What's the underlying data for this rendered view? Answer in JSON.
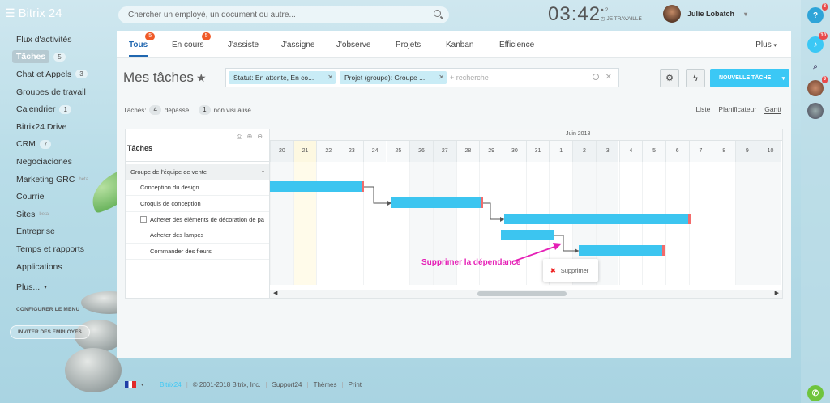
{
  "app": {
    "logo_a": "Bitrix",
    "logo_b": "24"
  },
  "search": {
    "placeholder": "Chercher un employé, un document ou autre..."
  },
  "clock": {
    "time": "03:42",
    "count": "2",
    "status": "JE TRAVAILLE"
  },
  "user": {
    "name": "Julie Lobatch"
  },
  "sidebar": {
    "items": [
      {
        "label": "Flux d'activités",
        "badge": ""
      },
      {
        "label": "Tâches",
        "badge": "5"
      },
      {
        "label": "Chat et Appels",
        "badge": "3"
      },
      {
        "label": "Groupes de travail",
        "badge": ""
      },
      {
        "label": "Calendrier",
        "badge": "1"
      },
      {
        "label": "Bitrix24.Drive",
        "badge": ""
      },
      {
        "label": "CRM",
        "badge": "7"
      },
      {
        "label": "Negociaciones",
        "badge": ""
      },
      {
        "label": "Marketing GRC",
        "badge": "",
        "sup": "beta"
      },
      {
        "label": "Courriel",
        "badge": ""
      },
      {
        "label": "Sites",
        "badge": "",
        "sup": "beta"
      },
      {
        "label": "Entreprise",
        "badge": ""
      },
      {
        "label": "Temps et rapports",
        "badge": ""
      },
      {
        "label": "Applications",
        "badge": ""
      },
      {
        "label": "Plus...",
        "badge": ""
      }
    ],
    "configure": "CONFIGURER LE MENU",
    "invite": "INVITER DES EMPLOYÉS"
  },
  "right_panel": {
    "help_badge": "8",
    "notif_badge": "10",
    "avatar_badge": "3"
  },
  "tabs": [
    {
      "label": "Tous",
      "count": "5"
    },
    {
      "label": "En cours",
      "count": "5"
    },
    {
      "label": "J'assiste",
      "count": ""
    },
    {
      "label": "J'assigne",
      "count": ""
    },
    {
      "label": "J'observe",
      "count": ""
    },
    {
      "label": "Projets",
      "count": ""
    },
    {
      "label": "Kanban",
      "count": ""
    },
    {
      "label": "Efficience",
      "count": ""
    }
  ],
  "tabs_more": "Plus",
  "page": {
    "title": "Mes tâches",
    "filter_chips": [
      "Statut: En attente, En co...",
      "Projet (groupe): Groupe ..."
    ],
    "filter_search": "+ recherche",
    "new_task": "NOUVELLE TÂCHE"
  },
  "stats": {
    "prefix": "Tâches:",
    "overdue_count": "4",
    "overdue_label": "dépassé",
    "unseen_count": "1",
    "unseen_label": "non visualisé"
  },
  "views": [
    "Liste",
    "Planificateur",
    "Gantt"
  ],
  "gantt": {
    "header": "Tâches",
    "month": "Juin 2018",
    "days": [
      "20",
      "21",
      "22",
      "23",
      "24",
      "25",
      "26",
      "27",
      "28",
      "29",
      "30",
      "31",
      "1",
      "2",
      "3",
      "4",
      "5",
      "6",
      "7",
      "8",
      "9",
      "10"
    ],
    "rows": [
      {
        "label": "Groupe de l'équipe de vente",
        "type": "group"
      },
      {
        "label": "Conception du design",
        "type": "task"
      },
      {
        "label": "Croquis de conception",
        "type": "task"
      },
      {
        "label": "Acheter des éléments de décoration de pa",
        "type": "parent"
      },
      {
        "label": "Acheter des lampes",
        "type": "sub"
      },
      {
        "label": "Commander des fleurs",
        "type": "sub"
      }
    ]
  },
  "popup": {
    "label": "Supprimer"
  },
  "annotation": "Supprimer la dépendance",
  "footer": {
    "logo": "Bitrix24",
    "copyright": "© 2001-2018 Bitrix, Inc.",
    "support": "Support24",
    "themes": "Thèmes",
    "print": "Print"
  }
}
